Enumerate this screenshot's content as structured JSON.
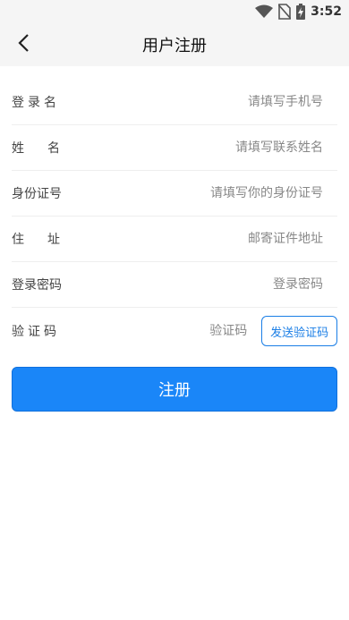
{
  "status_bar": {
    "time": "3:52",
    "icons": [
      "wifi-icon",
      "no-sim-icon",
      "battery-charging-icon"
    ]
  },
  "app_bar": {
    "back_icon": "chevron-left-icon",
    "title": "用户注册"
  },
  "form": {
    "username": {
      "label": "登录名",
      "placeholder": "请填写手机号",
      "value": ""
    },
    "name": {
      "label": "姓名",
      "placeholder": "请填写联系姓名",
      "value": ""
    },
    "id_number": {
      "label": "身份证号",
      "placeholder": "请填写你的身份证号",
      "value": ""
    },
    "address": {
      "label": "住址",
      "placeholder": "邮寄证件地址",
      "value": ""
    },
    "password": {
      "label": "登录密码",
      "placeholder": "登录密码",
      "value": ""
    },
    "verification": {
      "label": "验证码",
      "placeholder": "验证码",
      "value": "",
      "send_button": "发送验证码"
    }
  },
  "register_button": "注册",
  "colors": {
    "primary": "#1a86f8",
    "outline_blue": "#1a7ee6",
    "header_bg": "#f5f5f5"
  }
}
